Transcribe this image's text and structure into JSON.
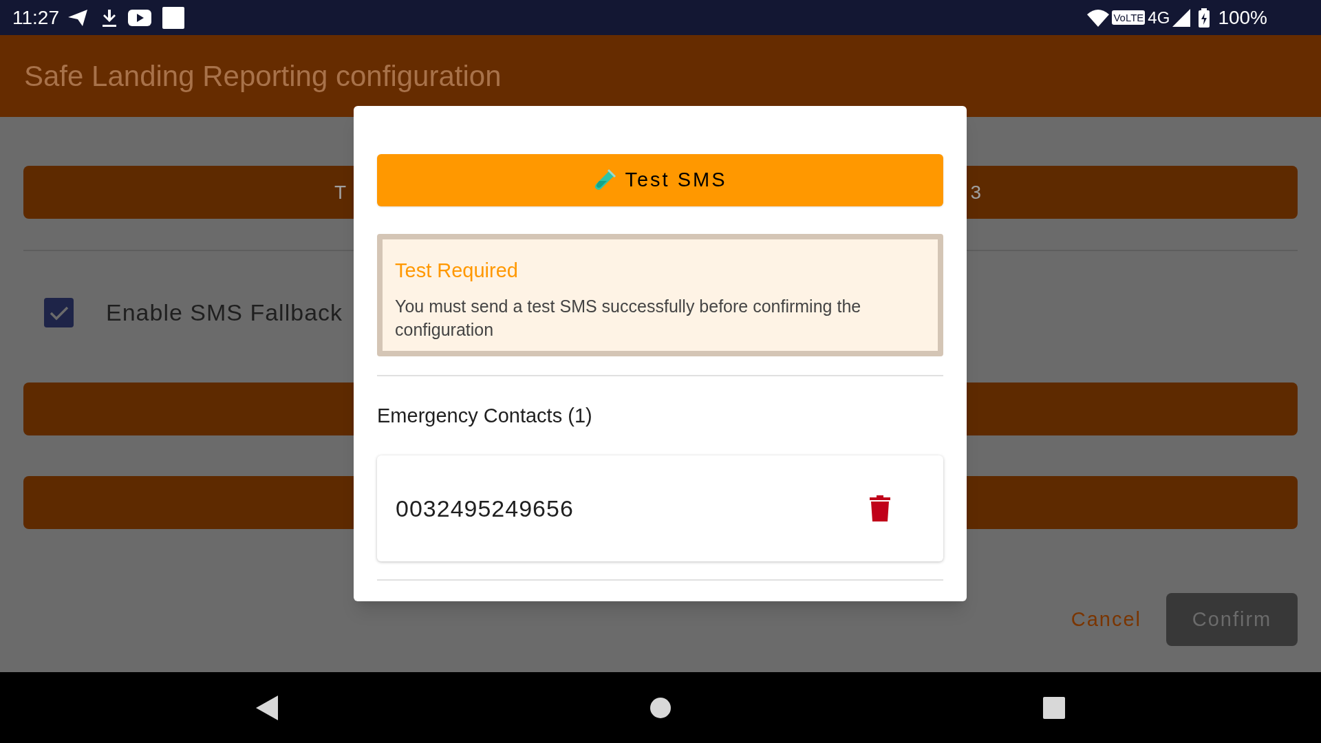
{
  "status_bar": {
    "time": "11:27",
    "volte": "VoLTE",
    "network": "4G",
    "battery": "100%"
  },
  "app_bar": {
    "title": "Safe Landing Reporting configuration"
  },
  "first_button_fragments": [
    "T",
    "3"
  ],
  "fallback_checkbox": {
    "label": "Enable SMS Fallback",
    "checked": true
  },
  "footer": {
    "cancel": "Cancel",
    "confirm": {
      "label": "Confirm",
      "disabled": true
    }
  },
  "dialog": {
    "test_button": {
      "label": "Test SMS"
    },
    "alert": {
      "title": "Test Required",
      "message": "You must send a test SMS successfully before confirming the configuration"
    },
    "contacts_heading": "Emergency Contacts (1)",
    "contacts": [
      {
        "number": "0032495249656"
      }
    ]
  }
}
